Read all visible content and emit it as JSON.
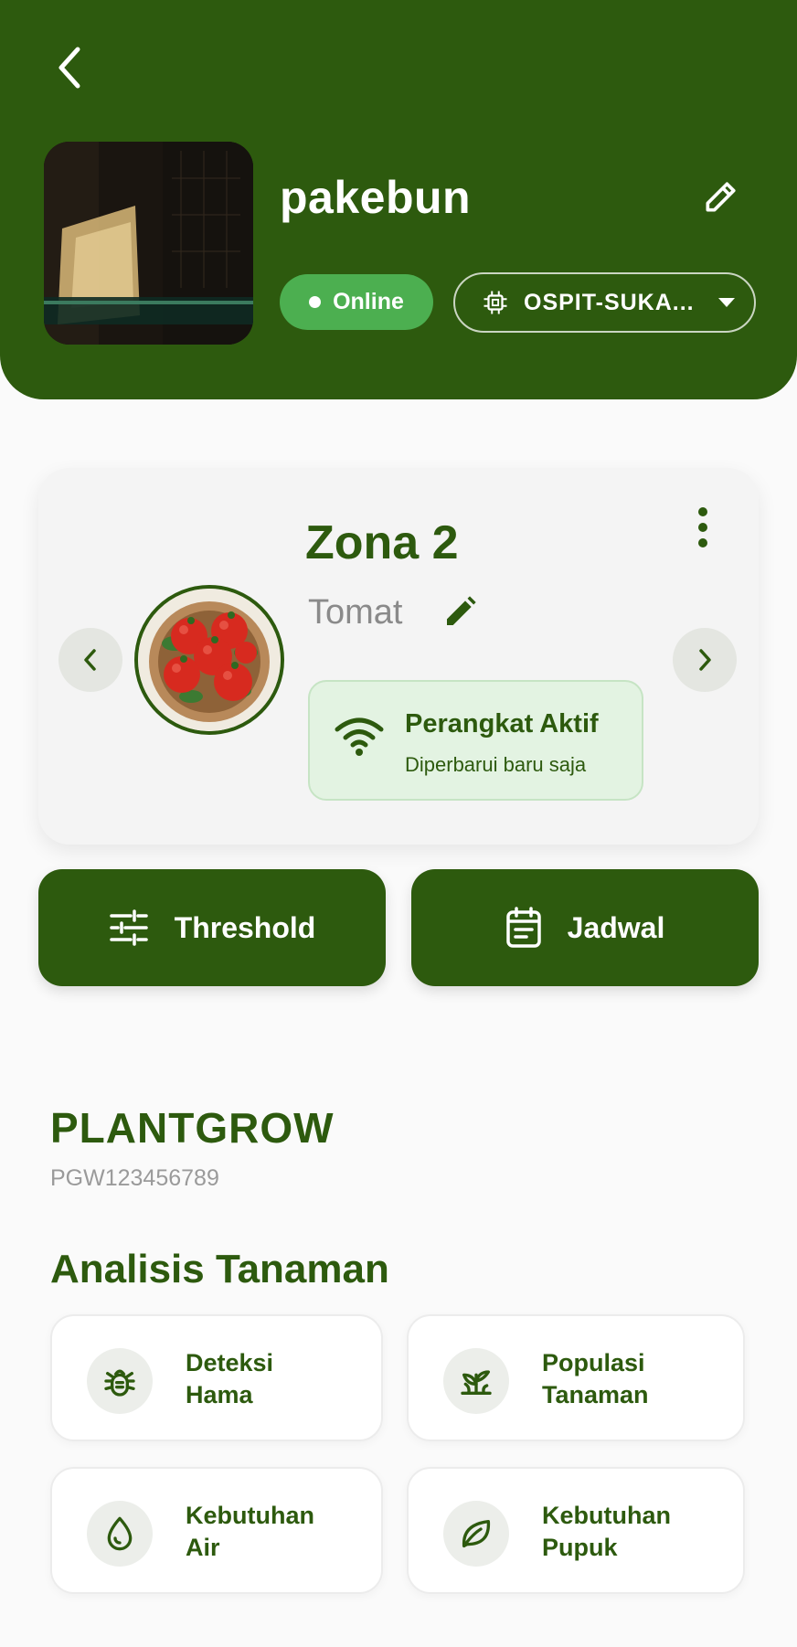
{
  "profile": {
    "name": "pakebun",
    "status": "Online",
    "device_selector": "OSPIT-SUKA..."
  },
  "zone": {
    "title": "Zona 2",
    "plant": "Tomat",
    "status_title": "Perangkat Aktif",
    "status_subtitle": "Diperbarui baru saja"
  },
  "actions": {
    "threshold": "Threshold",
    "schedule": "Jadwal"
  },
  "device": {
    "name": "PLANTGROW",
    "id": "PGW123456789"
  },
  "analysis": {
    "title": "Analisis Tanaman",
    "items": [
      {
        "line1": "Deteksi",
        "line2": "Hama",
        "icon": "bug-icon"
      },
      {
        "line1": "Populasi",
        "line2": "Tanaman",
        "icon": "sprout-icon"
      },
      {
        "line1": "Kebutuhan",
        "line2": "Air",
        "icon": "water-drop-icon"
      },
      {
        "line1": "Kebutuhan",
        "line2": "Pupuk",
        "icon": "leaf-icon"
      }
    ]
  },
  "colors": {
    "primary": "#2d5a0e",
    "online": "#4caf50",
    "status_bg": "#e3f3e2"
  }
}
